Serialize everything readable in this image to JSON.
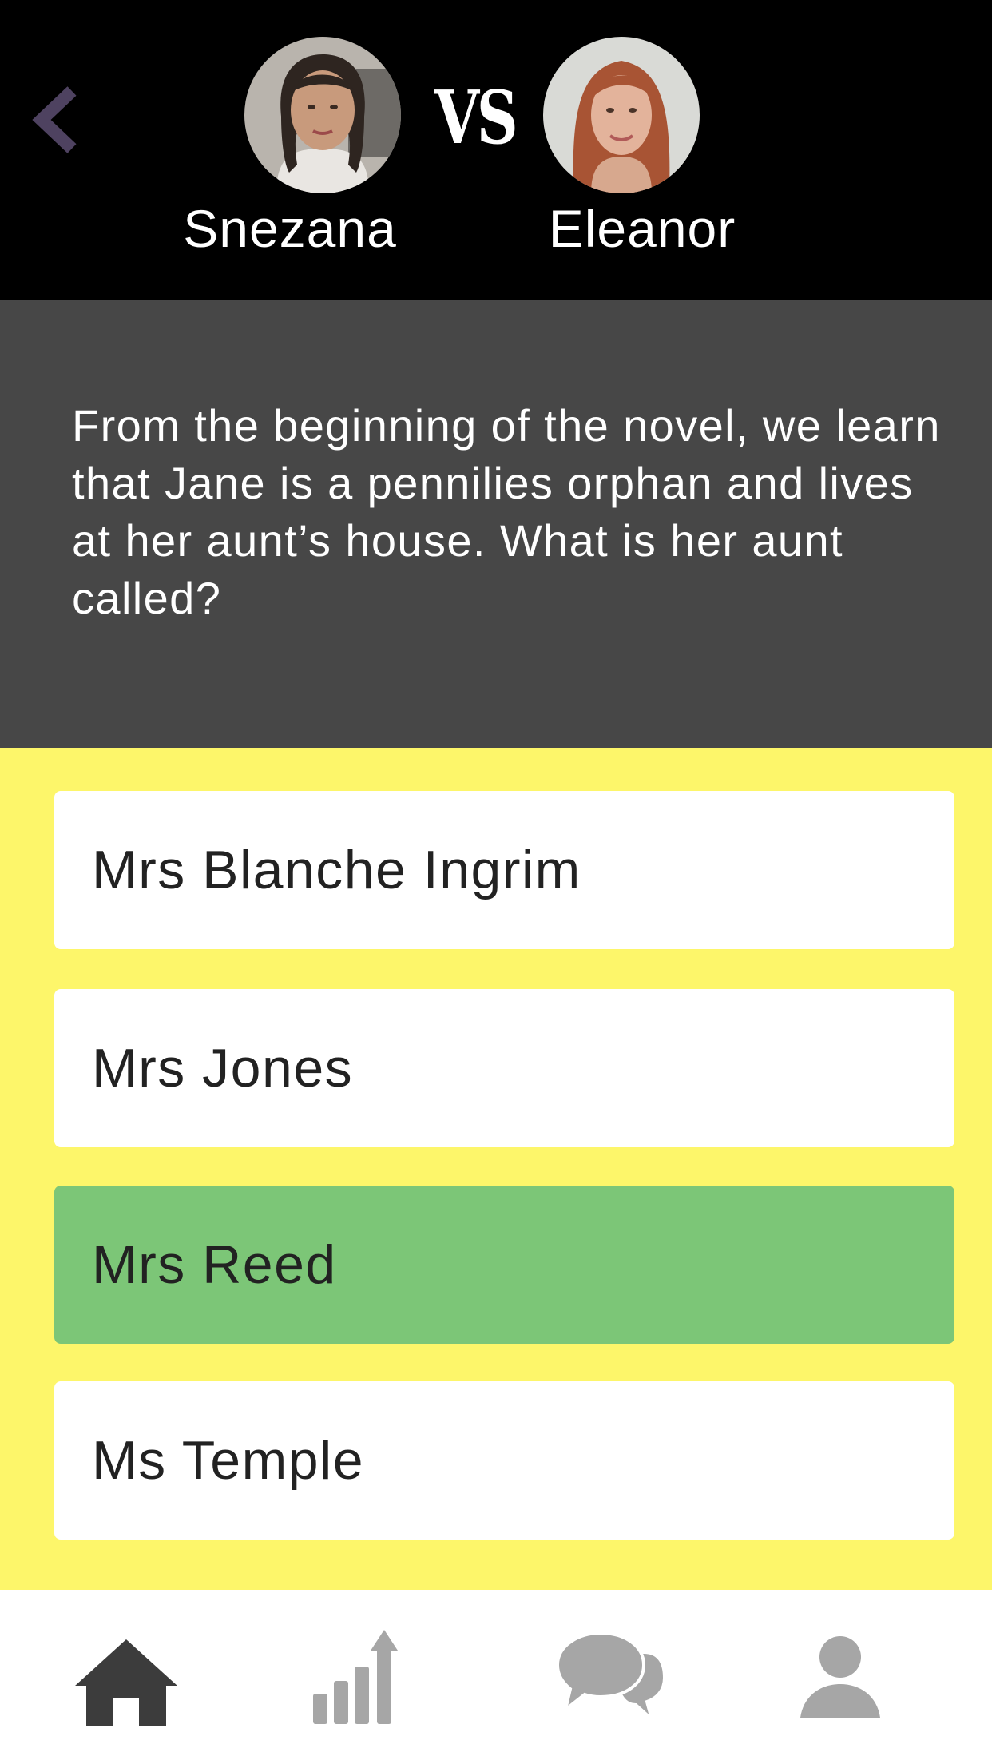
{
  "header": {
    "vs_label": "VS",
    "player_left": {
      "name": "Snezana"
    },
    "player_right": {
      "name": "Eleanor"
    }
  },
  "question": {
    "text": "From the beginning of the novel, we learn that Jane is a pennilies orphan and lives at her aunt’s house. What is her aunt called?"
  },
  "answers": [
    {
      "label": "Mrs Blanche Ingrim",
      "state": "default"
    },
    {
      "label": "Mrs Jones",
      "state": "default"
    },
    {
      "label": "Mrs Reed",
      "state": "correct"
    },
    {
      "label": "Ms Temple",
      "state": "default"
    }
  ],
  "tabbar": {
    "items": [
      {
        "icon": "home-icon",
        "active": true
      },
      {
        "icon": "stats-icon",
        "active": false
      },
      {
        "icon": "chat-icon",
        "active": false
      },
      {
        "icon": "profile-icon",
        "active": false
      }
    ]
  },
  "colors": {
    "header_bg": "#000000",
    "question_bg": "#474747",
    "answers_bg": "#fdf66a",
    "correct_answer": "#7cc677",
    "back_chevron": "#4e4260",
    "tab_active": "#3c3c3c",
    "tab_inactive": "#a6a6a6"
  }
}
